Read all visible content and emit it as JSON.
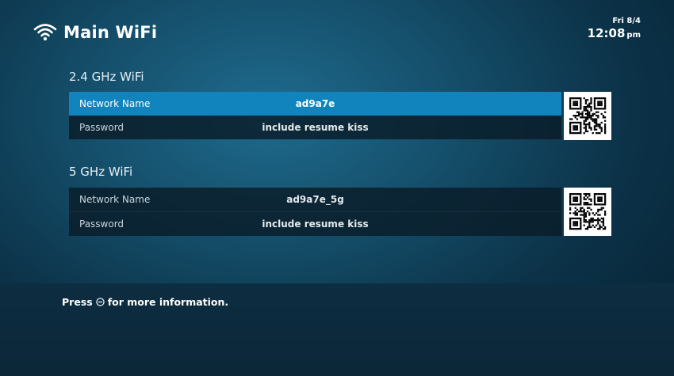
{
  "header": {
    "title": "Main WiFi",
    "icon": "wifi-icon"
  },
  "clock": {
    "date": "Fri 8/4",
    "time": "12:08",
    "ampm": "pm"
  },
  "sections": [
    {
      "title": "2.4 GHz WiFi",
      "rows": [
        {
          "label": "Network Name",
          "value": "ad9a7e",
          "selected": true
        },
        {
          "label": "Password",
          "value": "include resume kiss",
          "selected": false
        }
      ],
      "qr_icon": "qr-code-icon"
    },
    {
      "title": "5 GHz WiFi",
      "rows": [
        {
          "label": "Network Name",
          "value": "ad9a7e_5g",
          "selected": false
        },
        {
          "label": "Password",
          "value": "include resume kiss",
          "selected": false
        }
      ],
      "qr_icon": "qr-code-icon"
    }
  ],
  "footer": {
    "prefix": "Press",
    "button_icon": "minus-circle-icon",
    "suffix": "for more information."
  },
  "colors": {
    "selected_row": "#1184bd",
    "row_background": "#0a1c28",
    "footer_background": "#0b2738"
  }
}
